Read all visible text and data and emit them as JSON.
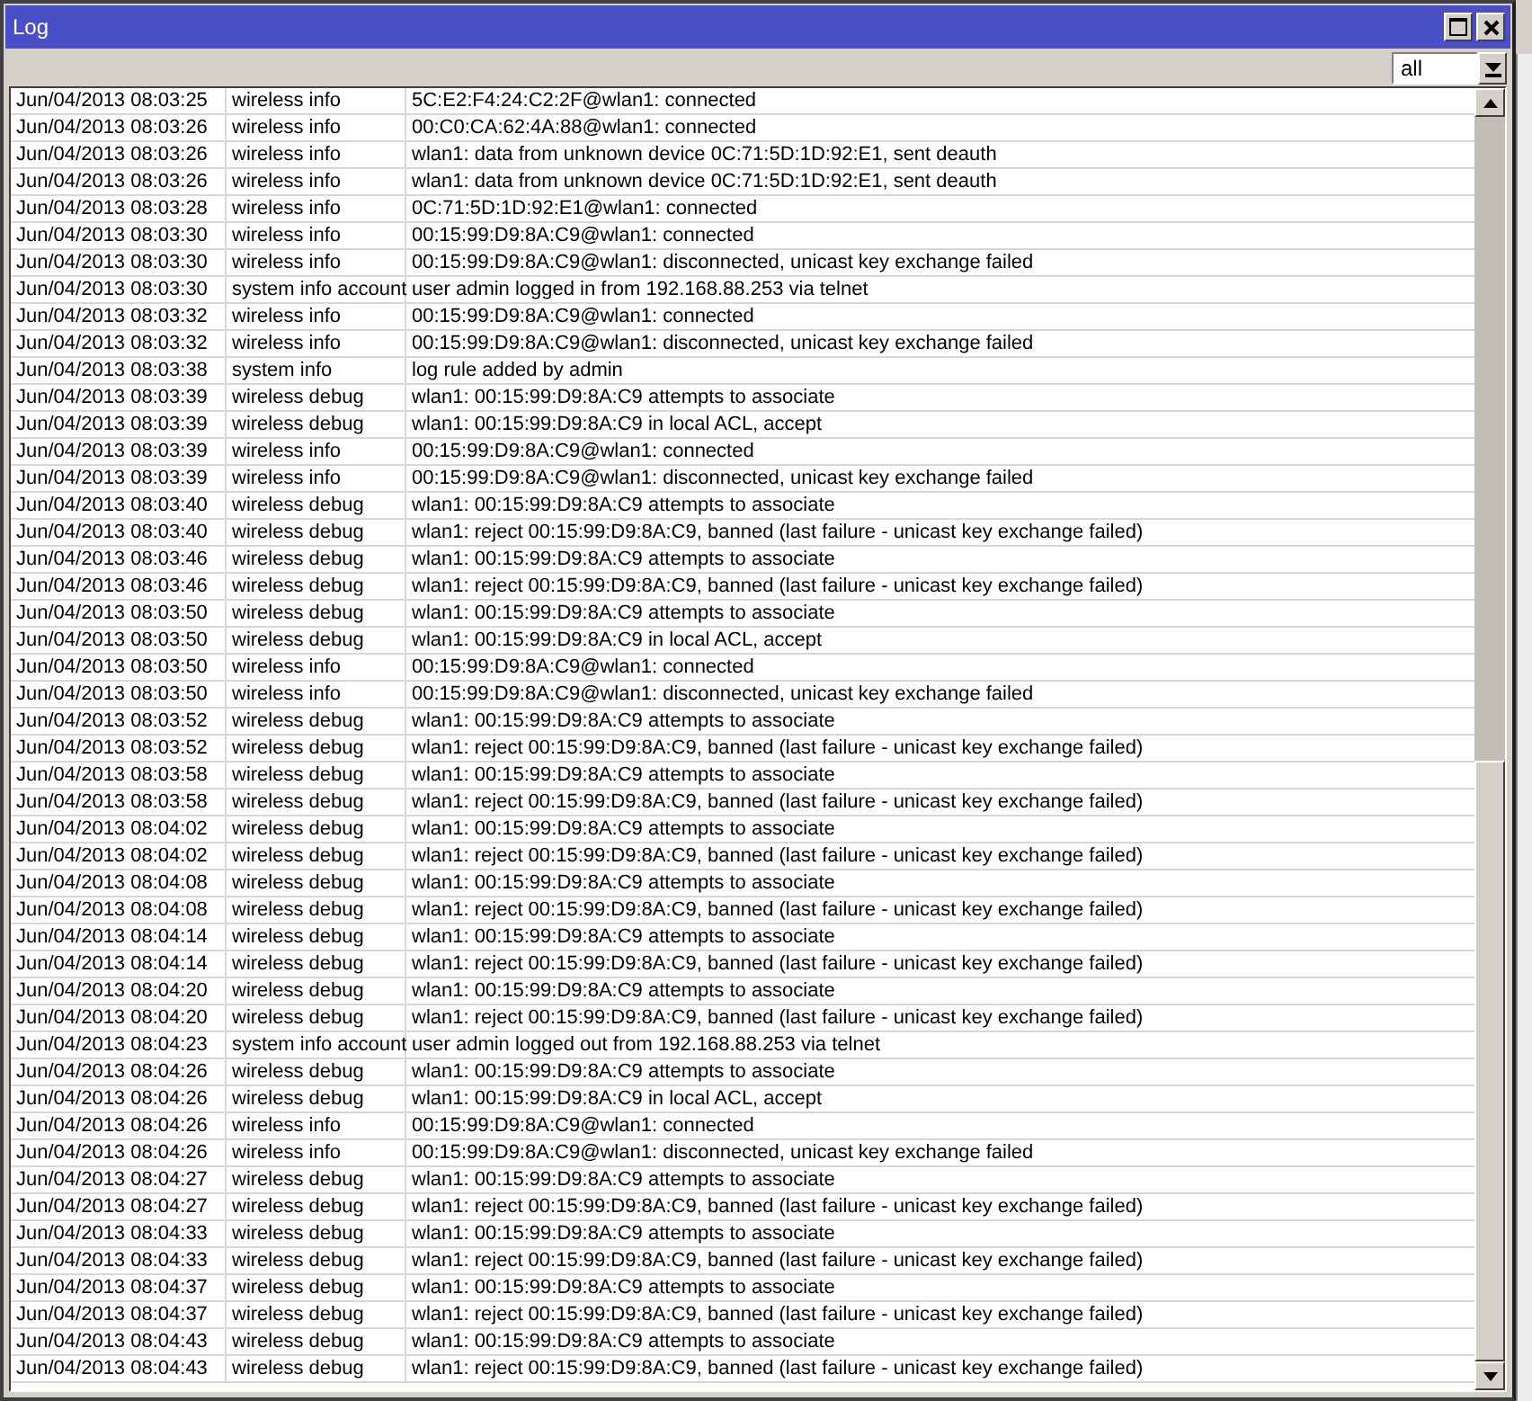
{
  "window": {
    "title": "Log"
  },
  "filter": {
    "value": "all"
  },
  "table": {
    "rows": [
      {
        "time": "Jun/04/2013 08:03:25",
        "topics": "wireless info",
        "message": "5C:E2:F4:24:C2:2F@wlan1: connected"
      },
      {
        "time": "Jun/04/2013 08:03:26",
        "topics": "wireless info",
        "message": "00:C0:CA:62:4A:88@wlan1: connected"
      },
      {
        "time": "Jun/04/2013 08:03:26",
        "topics": "wireless info",
        "message": "wlan1: data from unknown device 0C:71:5D:1D:92:E1, sent deauth"
      },
      {
        "time": "Jun/04/2013 08:03:26",
        "topics": "wireless info",
        "message": "wlan1: data from unknown device 0C:71:5D:1D:92:E1, sent deauth"
      },
      {
        "time": "Jun/04/2013 08:03:28",
        "topics": "wireless info",
        "message": "0C:71:5D:1D:92:E1@wlan1: connected"
      },
      {
        "time": "Jun/04/2013 08:03:30",
        "topics": "wireless info",
        "message": "00:15:99:D9:8A:C9@wlan1: connected"
      },
      {
        "time": "Jun/04/2013 08:03:30",
        "topics": "wireless info",
        "message": "00:15:99:D9:8A:C9@wlan1: disconnected, unicast key exchange failed"
      },
      {
        "time": "Jun/04/2013 08:03:30",
        "topics": "system info account",
        "message": "user admin logged in from 192.168.88.253 via telnet"
      },
      {
        "time": "Jun/04/2013 08:03:32",
        "topics": "wireless info",
        "message": "00:15:99:D9:8A:C9@wlan1: connected"
      },
      {
        "time": "Jun/04/2013 08:03:32",
        "topics": "wireless info",
        "message": "00:15:99:D9:8A:C9@wlan1: disconnected, unicast key exchange failed"
      },
      {
        "time": "Jun/04/2013 08:03:38",
        "topics": "system info",
        "message": "log rule added by admin"
      },
      {
        "time": "Jun/04/2013 08:03:39",
        "topics": "wireless debug",
        "message": "wlan1: 00:15:99:D9:8A:C9 attempts to associate"
      },
      {
        "time": "Jun/04/2013 08:03:39",
        "topics": "wireless debug",
        "message": "wlan1: 00:15:99:D9:8A:C9 in local ACL, accept"
      },
      {
        "time": "Jun/04/2013 08:03:39",
        "topics": "wireless info",
        "message": "00:15:99:D9:8A:C9@wlan1: connected"
      },
      {
        "time": "Jun/04/2013 08:03:39",
        "topics": "wireless info",
        "message": "00:15:99:D9:8A:C9@wlan1: disconnected, unicast key exchange failed"
      },
      {
        "time": "Jun/04/2013 08:03:40",
        "topics": "wireless debug",
        "message": "wlan1: 00:15:99:D9:8A:C9 attempts to associate"
      },
      {
        "time": "Jun/04/2013 08:03:40",
        "topics": "wireless debug",
        "message": "wlan1: reject 00:15:99:D9:8A:C9, banned (last failure - unicast key exchange failed)"
      },
      {
        "time": "Jun/04/2013 08:03:46",
        "topics": "wireless debug",
        "message": "wlan1: 00:15:99:D9:8A:C9 attempts to associate"
      },
      {
        "time": "Jun/04/2013 08:03:46",
        "topics": "wireless debug",
        "message": "wlan1: reject 00:15:99:D9:8A:C9, banned (last failure - unicast key exchange failed)"
      },
      {
        "time": "Jun/04/2013 08:03:50",
        "topics": "wireless debug",
        "message": "wlan1: 00:15:99:D9:8A:C9 attempts to associate"
      },
      {
        "time": "Jun/04/2013 08:03:50",
        "topics": "wireless debug",
        "message": "wlan1: 00:15:99:D9:8A:C9 in local ACL, accept"
      },
      {
        "time": "Jun/04/2013 08:03:50",
        "topics": "wireless info",
        "message": "00:15:99:D9:8A:C9@wlan1: connected"
      },
      {
        "time": "Jun/04/2013 08:03:50",
        "topics": "wireless info",
        "message": "00:15:99:D9:8A:C9@wlan1: disconnected, unicast key exchange failed"
      },
      {
        "time": "Jun/04/2013 08:03:52",
        "topics": "wireless debug",
        "message": "wlan1: 00:15:99:D9:8A:C9 attempts to associate"
      },
      {
        "time": "Jun/04/2013 08:03:52",
        "topics": "wireless debug",
        "message": "wlan1: reject 00:15:99:D9:8A:C9, banned (last failure - unicast key exchange failed)"
      },
      {
        "time": "Jun/04/2013 08:03:58",
        "topics": "wireless debug",
        "message": "wlan1: 00:15:99:D9:8A:C9 attempts to associate"
      },
      {
        "time": "Jun/04/2013 08:03:58",
        "topics": "wireless debug",
        "message": "wlan1: reject 00:15:99:D9:8A:C9, banned (last failure - unicast key exchange failed)"
      },
      {
        "time": "Jun/04/2013 08:04:02",
        "topics": "wireless debug",
        "message": "wlan1: 00:15:99:D9:8A:C9 attempts to associate"
      },
      {
        "time": "Jun/04/2013 08:04:02",
        "topics": "wireless debug",
        "message": "wlan1: reject 00:15:99:D9:8A:C9, banned (last failure - unicast key exchange failed)"
      },
      {
        "time": "Jun/04/2013 08:04:08",
        "topics": "wireless debug",
        "message": "wlan1: 00:15:99:D9:8A:C9 attempts to associate"
      },
      {
        "time": "Jun/04/2013 08:04:08",
        "topics": "wireless debug",
        "message": "wlan1: reject 00:15:99:D9:8A:C9, banned (last failure - unicast key exchange failed)"
      },
      {
        "time": "Jun/04/2013 08:04:14",
        "topics": "wireless debug",
        "message": "wlan1: 00:15:99:D9:8A:C9 attempts to associate"
      },
      {
        "time": "Jun/04/2013 08:04:14",
        "topics": "wireless debug",
        "message": "wlan1: reject 00:15:99:D9:8A:C9, banned (last failure - unicast key exchange failed)"
      },
      {
        "time": "Jun/04/2013 08:04:20",
        "topics": "wireless debug",
        "message": "wlan1: 00:15:99:D9:8A:C9 attempts to associate"
      },
      {
        "time": "Jun/04/2013 08:04:20",
        "topics": "wireless debug",
        "message": "wlan1: reject 00:15:99:D9:8A:C9, banned (last failure - unicast key exchange failed)"
      },
      {
        "time": "Jun/04/2013 08:04:23",
        "topics": "system info account",
        "message": "user admin logged out from 192.168.88.253 via telnet"
      },
      {
        "time": "Jun/04/2013 08:04:26",
        "topics": "wireless debug",
        "message": "wlan1: 00:15:99:D9:8A:C9 attempts to associate"
      },
      {
        "time": "Jun/04/2013 08:04:26",
        "topics": "wireless debug",
        "message": "wlan1: 00:15:99:D9:8A:C9 in local ACL, accept"
      },
      {
        "time": "Jun/04/2013 08:04:26",
        "topics": "wireless info",
        "message": "00:15:99:D9:8A:C9@wlan1: connected"
      },
      {
        "time": "Jun/04/2013 08:04:26",
        "topics": "wireless info",
        "message": "00:15:99:D9:8A:C9@wlan1: disconnected, unicast key exchange failed"
      },
      {
        "time": "Jun/04/2013 08:04:27",
        "topics": "wireless debug",
        "message": "wlan1: 00:15:99:D9:8A:C9 attempts to associate"
      },
      {
        "time": "Jun/04/2013 08:04:27",
        "topics": "wireless debug",
        "message": "wlan1: reject 00:15:99:D9:8A:C9, banned (last failure - unicast key exchange failed)"
      },
      {
        "time": "Jun/04/2013 08:04:33",
        "topics": "wireless debug",
        "message": "wlan1: 00:15:99:D9:8A:C9 attempts to associate"
      },
      {
        "time": "Jun/04/2013 08:04:33",
        "topics": "wireless debug",
        "message": "wlan1: reject 00:15:99:D9:8A:C9, banned (last failure - unicast key exchange failed)"
      },
      {
        "time": "Jun/04/2013 08:04:37",
        "topics": "wireless debug",
        "message": "wlan1: 00:15:99:D9:8A:C9 attempts to associate"
      },
      {
        "time": "Jun/04/2013 08:04:37",
        "topics": "wireless debug",
        "message": "wlan1: reject 00:15:99:D9:8A:C9, banned (last failure - unicast key exchange failed)"
      },
      {
        "time": "Jun/04/2013 08:04:43",
        "topics": "wireless debug",
        "message": "wlan1: 00:15:99:D9:8A:C9 attempts to associate"
      },
      {
        "time": "Jun/04/2013 08:04:43",
        "topics": "wireless debug",
        "message": "wlan1: reject 00:15:99:D9:8A:C9, banned (last failure - unicast key exchange failed)"
      }
    ]
  }
}
